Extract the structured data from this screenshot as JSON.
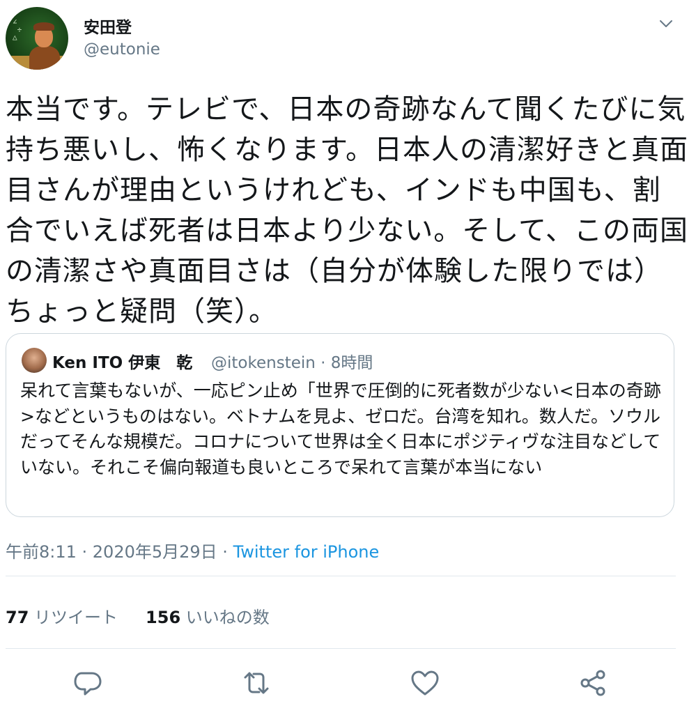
{
  "author": {
    "name": "安田登",
    "handle": "@eutonie"
  },
  "tweet": {
    "text": "本当です。テレビで、日本の奇跡なんて聞くたびに気持ち悪いし、怖くなります。日本人の清潔好きと真面目さんが理由というけれども、インドも中国も、割合でいえば死者は日本より少ない。そして、この両国の清潔さや真面目さは（自分が体験した限りでは）ちょっと疑問（笑）。"
  },
  "quoted_tweet": {
    "name": "Ken ITO 伊東　乾",
    "handle_time": "@itokenstein · 8時間",
    "text": "呆れて言葉もないが、一応ピン止め「世界で圧倒的に死者数が少ない<日本の奇跡>などというものはない。ベトナムを見よ、ゼロだ。台湾を知れ。数人だ。ソウルだってそんな規模だ。コロナについて世界は全く日本にポジティヴな注目などしていない。それこそ偏向報道も良いところで呆れて言葉が本当にない"
  },
  "meta": {
    "timestamp": "午前8:11 · 2020年5月29日",
    "separator": " · ",
    "source": "Twitter for iPhone"
  },
  "stats": {
    "retweets_count": "77",
    "retweets_label": "リツイート",
    "likes_count": "156",
    "likes_label": "いいねの数"
  },
  "icons": {
    "menu": "chevron-down-icon",
    "reply": "reply-icon",
    "retweet": "retweet-icon",
    "like": "heart-icon",
    "share": "share-icon"
  },
  "colors": {
    "link": "#1b95e0",
    "secondary": "#657786",
    "border": "#ccd6dd"
  }
}
